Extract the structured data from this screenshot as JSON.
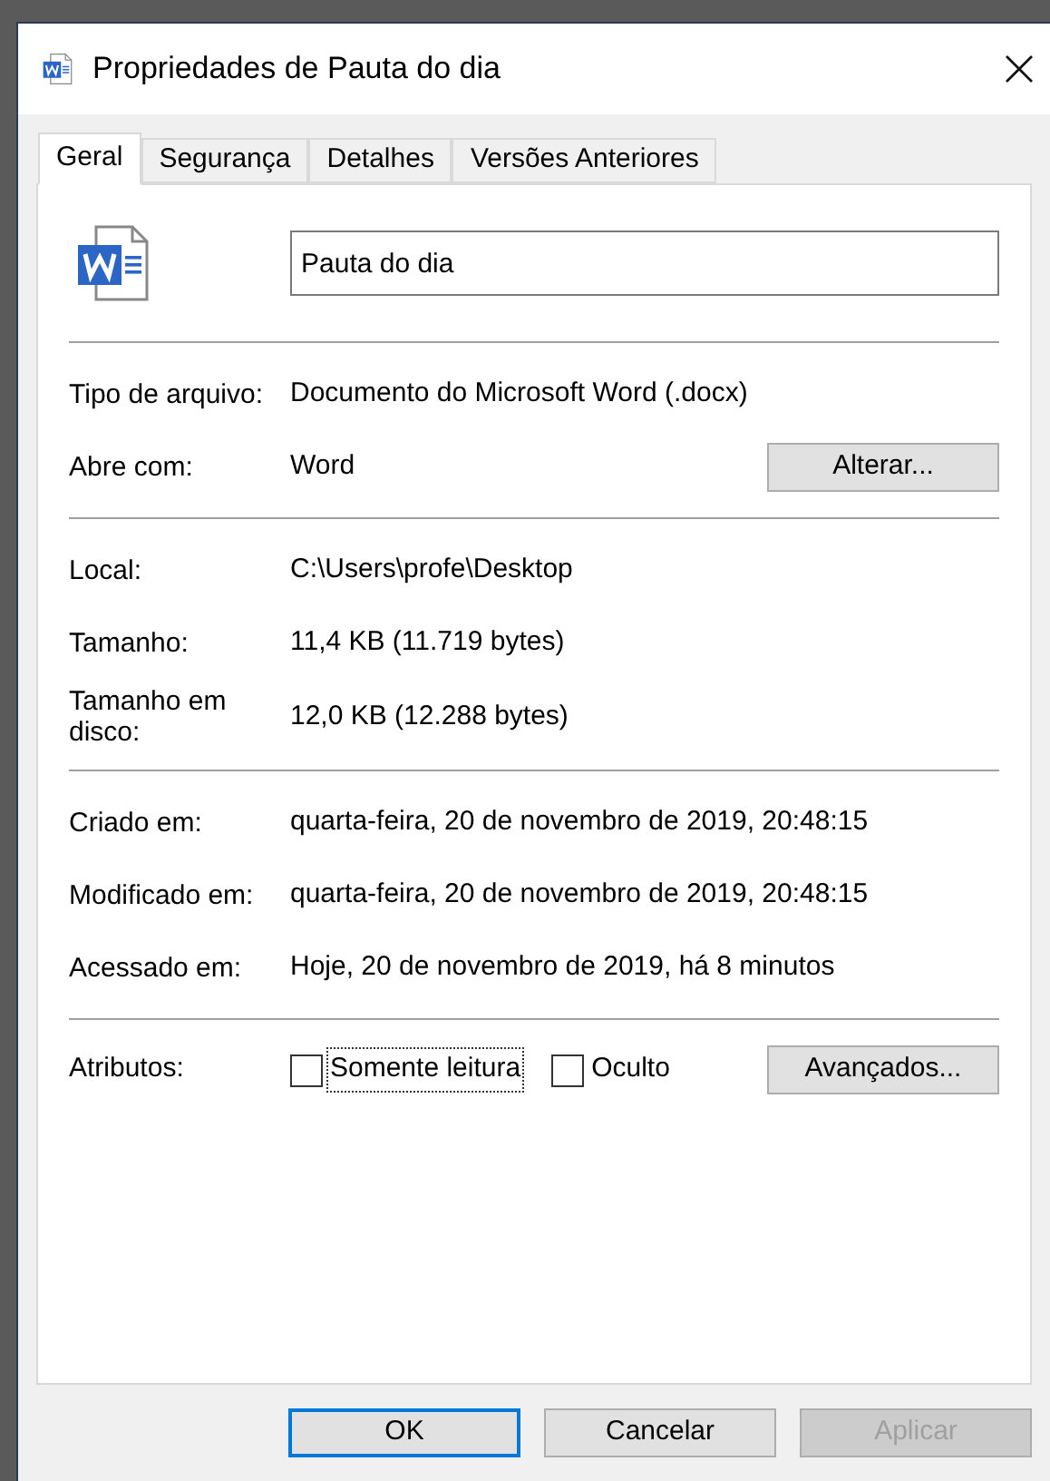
{
  "window": {
    "title": "Propriedades de Pauta do dia"
  },
  "tabs": [
    {
      "label": "Geral",
      "selected": true
    },
    {
      "label": "Segurança",
      "selected": false
    },
    {
      "label": "Detalhes",
      "selected": false
    },
    {
      "label": "Versões Anteriores",
      "selected": false
    }
  ],
  "name_field": {
    "value": "Pauta do dia"
  },
  "sections": [
    {
      "rows": [
        {
          "label": "Tipo de arquivo:",
          "value": "Documento do Microsoft Word (.docx)"
        },
        {
          "label": "Abre com:",
          "value": "Word",
          "button": "Alterar..."
        }
      ]
    },
    {
      "rows": [
        {
          "label": "Local:",
          "value": "C:\\Users\\profe\\Desktop"
        },
        {
          "label": "Tamanho:",
          "value": "11,4 KB (11.719 bytes)"
        },
        {
          "label": "Tamanho em disco:",
          "value": "12,0 KB (12.288 bytes)"
        }
      ]
    },
    {
      "rows": [
        {
          "label": "Criado em:",
          "value": "quarta-feira, 20 de novembro de 2019, 20:48:15"
        },
        {
          "label": "Modificado em:",
          "value": "quarta-feira, 20 de novembro de 2019, 20:48:15"
        },
        {
          "label": "Acessado em:",
          "value": "Hoje, 20 de novembro de 2019, há 8 minutos"
        }
      ]
    }
  ],
  "attributes": {
    "label": "Atributos:",
    "checkboxes": [
      {
        "label": "Somente leitura",
        "checked": false,
        "focused": true
      },
      {
        "label": "Oculto",
        "checked": false,
        "focused": false
      }
    ],
    "button": "Avançados..."
  },
  "buttons": [
    {
      "label": "OK",
      "default": true,
      "disabled": false
    },
    {
      "label": "Cancelar",
      "default": false,
      "disabled": false
    },
    {
      "label": "Aplicar",
      "default": false,
      "disabled": true
    }
  ]
}
